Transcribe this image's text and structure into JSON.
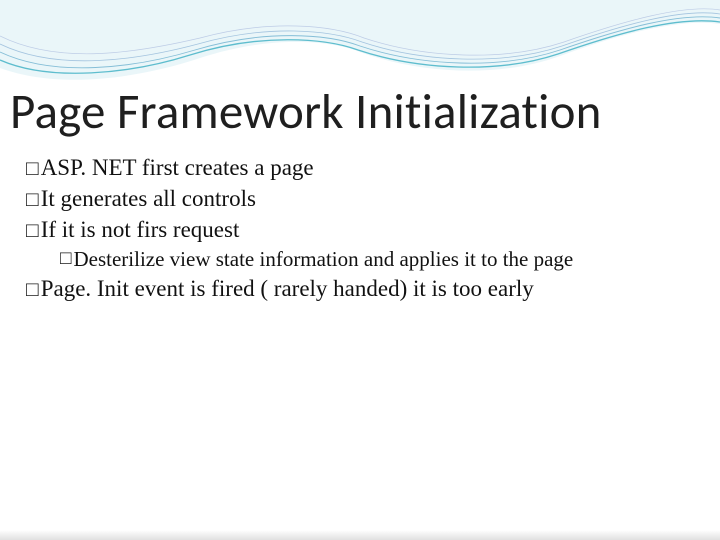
{
  "title": "Page Framework Initialization",
  "bullets": [
    {
      "level": 1,
      "text": "ASP. NET first creates a page"
    },
    {
      "level": 1,
      "text": "It generates all controls"
    },
    {
      "level": 1,
      "text": "If it is not firs request"
    },
    {
      "level": 2,
      "text": "Desterilize view state information and applies it to the page"
    },
    {
      "level": 1,
      "text": "Page. Init event is fired ( rarely handed) it is too early"
    }
  ],
  "bullet_marker": "□"
}
